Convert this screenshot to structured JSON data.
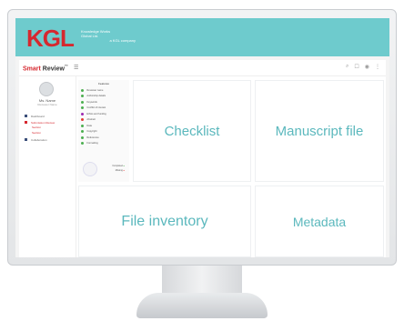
{
  "header": {
    "logo": "KGL",
    "logo_lines": [
      "Knowledge Works",
      "Global Ltd.",
      "a KGL company"
    ]
  },
  "app": {
    "brand_prefix": "Smart",
    "brand_suffix": " Review",
    "brand_mark": "™",
    "menu_icon": "☰"
  },
  "toolbar_icons": [
    "⌕",
    "☐",
    "◉",
    "⋮"
  ],
  "user": {
    "name": "Ms. Name",
    "role": "Reviewer Name"
  },
  "nav": {
    "items": [
      {
        "label": "Dashboard",
        "active": false
      },
      {
        "label": "Submission Review",
        "active": true
      }
    ],
    "sub_items": [
      "Section",
      "Section"
    ],
    "last": "Collaboration"
  },
  "checklist": {
    "title": "Features",
    "items": [
      {
        "label": "Reviewer name",
        "color": "#4caf50"
      },
      {
        "label": "Authorship details",
        "color": "#4caf50"
      },
      {
        "label": "Keywords",
        "color": "#4caf50"
      },
      {
        "label": "Conflict of interest",
        "color": "#4caf50"
      },
      {
        "label": "Ethics and funding",
        "color": "#9c27b0"
      },
      {
        "label": "Abstract",
        "color": "#e53935"
      },
      {
        "label": "Data",
        "color": "#4caf50"
      },
      {
        "label": "Copyright",
        "color": "#4caf50"
      },
      {
        "label": "References",
        "color": "#4caf50"
      },
      {
        "label": "Formatting",
        "color": "#4caf50"
      }
    ],
    "legend": [
      "Completed",
      "Missing"
    ]
  },
  "cards": {
    "checklist": "Checklist",
    "manuscript": "Manuscript file",
    "inventory": "File inventory",
    "metadata": "Metadata"
  }
}
